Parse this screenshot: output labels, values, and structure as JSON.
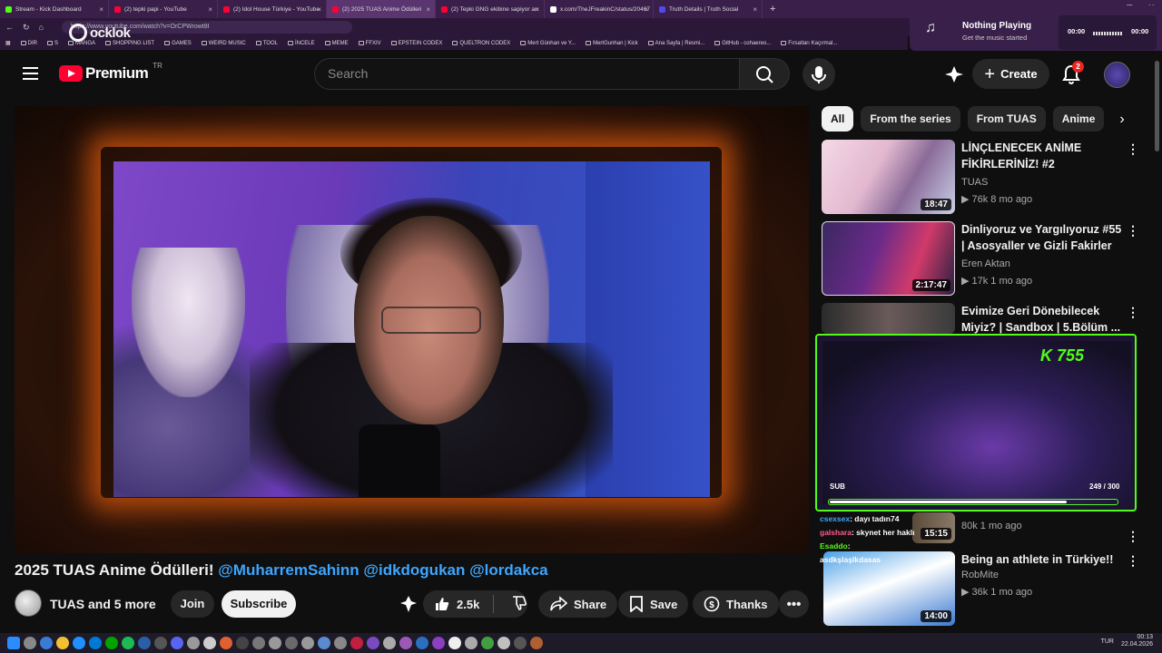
{
  "browser": {
    "tabs": [
      {
        "label": "Stream - Kick Dashboard",
        "color": "#53fc18"
      },
      {
        "label": "(2) tepki papi - YouTube",
        "color": "#ff0033"
      },
      {
        "label": "(2) Idol House Türkiye - YouTube",
        "color": "#ff0033"
      },
      {
        "label": "(2) 2025 TUAS Anime Ödülleri",
        "color": "#ff0033"
      },
      {
        "label": "(2) Tepki GNG ekibine sapiyor arı",
        "color": "#ff0033"
      },
      {
        "label": "x.com/TheJFreakinC/status/20467",
        "color": "#ffffff"
      },
      {
        "label": "Truth Details | Truth Social",
        "color": "#5448ee"
      }
    ],
    "url": "https://www.youtube.com/watch?v=OrCPWrowt8I",
    "bookmarks": [
      "DIR",
      "S",
      "MANGA",
      "SHOPPING LIST",
      "GAMES",
      "WEIRD MUSIC",
      "TOOL",
      "İNCELE",
      "MEME",
      "FFXIV",
      "EPSTEIN CODEX",
      "QUELTRON CODEX",
      "Mert Günhan ve Y...",
      "MertGunhan | Kick",
      "Ana Sayfa | Resmi...",
      "GitHub - cohaereo...",
      "Fırsatları Kaçırmal..."
    ]
  },
  "overlay": {
    "pocklok": "ocklok",
    "media_title": "Nothing Playing",
    "media_subtitle": "Get the music started",
    "time_start": "00:00",
    "time_end": "00:00"
  },
  "header": {
    "logo_text": "Premium",
    "region": "TR",
    "search_placeholder": "Search",
    "create_label": "Create",
    "notifications": "2"
  },
  "video": {
    "title_plain": "2025 TUAS Anime Ödülleri! ",
    "mentions": [
      "@MuharremSahinn",
      "@idkdogukan",
      "@lordakca"
    ],
    "channel": "TUAS and 5 more",
    "join": "Join",
    "subscribe": "Subscribe",
    "likes": "2.5k",
    "share": "Share",
    "save": "Save",
    "thanks": "Thanks"
  },
  "chips": [
    "All",
    "From the series",
    "From TUAS",
    "Anime"
  ],
  "recommendations": [
    {
      "title": "LİNÇLENECEK ANİME FİKİRLERİNİZ! #2",
      "channel": "TUAS",
      "meta": "▶ 76k  8 mo ago",
      "duration": "18:47"
    },
    {
      "title": "Dinliyoruz ve Yargılıyoruz #55 | Asosyaller ve Gizli Fakirler",
      "channel": "Eren Aktan",
      "meta": "▶ 17k  1 mo ago",
      "duration": "2:17:47"
    },
    {
      "title": "Evimize Geri Dönebilecek Miyiz? | Sandbox | 5.Bölüm ...",
      "channel": "",
      "meta": "",
      "duration": ""
    },
    {
      "title": "",
      "channel": "",
      "meta": "80k  1 mo ago",
      "duration": "15:15"
    },
    {
      "title": "Being an athlete in Türkiye!!",
      "channel": "RobMite",
      "meta": "▶ 36k  1 mo ago",
      "duration": "14:00"
    }
  ],
  "kick_overlay": {
    "count": "755",
    "sub_label": "SUB",
    "sub_count": "249 / 300",
    "sub_progress": 0.83
  },
  "chat": [
    {
      "user": "csexsex",
      "msg": "dayı tadın74",
      "color": "#3ea6ff"
    },
    {
      "user": "galshara",
      "msg": "skynet her haklı",
      "color": "#ff5a8a"
    },
    {
      "user": "Esaddo",
      "msg": "",
      "color": "#53fc18"
    },
    {
      "user": "",
      "msg": "asdkşlaşlkdasas",
      "color": "#c080ff"
    }
  ],
  "tray": {
    "lang": "TUR",
    "time": "00:13",
    "date": "22.04.2026"
  }
}
